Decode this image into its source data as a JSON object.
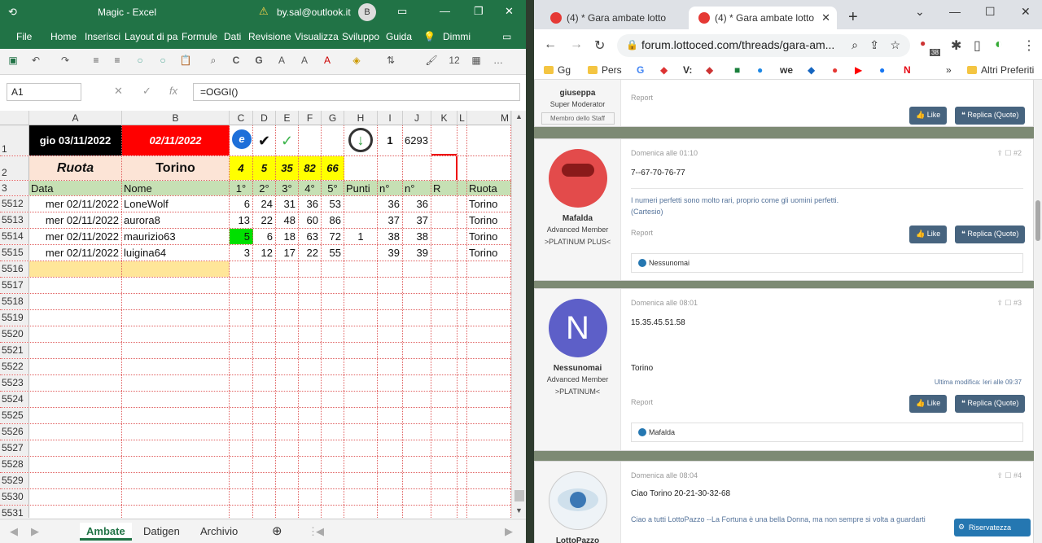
{
  "excel": {
    "title": "Magic - Excel",
    "account": "by.sal@outlook.it",
    "avatar": "B",
    "menu": [
      "File",
      "Home",
      "Inserisci",
      "Layout di pa",
      "Formule",
      "Dati",
      "Revisione",
      "Visualizza",
      "Sviluppo",
      "Guida",
      "Dimmi"
    ],
    "name_box": "A1",
    "formula": "=OGGI()",
    "fx": "fx",
    "columns": [
      "A",
      "B",
      "C",
      "D",
      "E",
      "F",
      "G",
      "H",
      "I",
      "J",
      "K",
      "L",
      "M"
    ],
    "row1": {
      "num": "1",
      "date_black": "gio 03/11/2022",
      "date_red": "02/11/2022",
      "i": "1",
      "j": "6293"
    },
    "row2": {
      "num": "2",
      "ruota": "Ruota",
      "city": "Torino",
      "nums": [
        "4",
        "5",
        "35",
        "82",
        "66"
      ]
    },
    "row3": {
      "num": "3",
      "headers": [
        "Data",
        "Nome",
        "1°",
        "2°",
        "3°",
        "4°",
        "5°",
        "Punti",
        "n°",
        "n°",
        "R",
        "",
        "Ruota"
      ]
    },
    "data_rows": [
      {
        "num": "5512",
        "data": "mer 02/11/2022",
        "nome": "LoneWolf",
        "v": [
          "6",
          "24",
          "31",
          "36",
          "53"
        ],
        "punti": "",
        "n1": "36",
        "n2": "36",
        "ruota": "Torino"
      },
      {
        "num": "5513",
        "data": "mer 02/11/2022",
        "nome": "aurora8",
        "v": [
          "13",
          "22",
          "48",
          "60",
          "86"
        ],
        "punti": "",
        "n1": "37",
        "n2": "37",
        "ruota": "Torino"
      },
      {
        "num": "5514",
        "data": "mer 02/11/2022",
        "nome": "maurizio63",
        "v": [
          "5",
          "6",
          "18",
          "63",
          "72"
        ],
        "punti": "1",
        "n1": "38",
        "n2": "38",
        "ruota": "Torino"
      },
      {
        "num": "5515",
        "data": "mer 02/11/2022",
        "nome": "luigina64",
        "v": [
          "3",
          "12",
          "17",
          "22",
          "55"
        ],
        "punti": "",
        "n1": "39",
        "n2": "39",
        "ruota": "Torino"
      }
    ],
    "empty_rows": [
      "5516",
      "5517",
      "5518",
      "5519",
      "5520",
      "5521",
      "5522",
      "5523",
      "5524",
      "5525",
      "5526",
      "5527",
      "5528",
      "5529",
      "5530",
      "5531"
    ],
    "sheets": [
      "Ambate",
      "Datigen",
      "Archivio"
    ],
    "active_sheet": "Ambate"
  },
  "browser": {
    "tab1": "(4) * Gara ambate lotto",
    "tab2": "(4) * Gara ambate lotto",
    "url": "forum.lottoced.com/threads/gara-am...",
    "ext_badge": "38",
    "bookmarks": [
      "Gg",
      "Pers",
      "Altri Preferiti"
    ],
    "posts": [
      {
        "user": "giuseppa",
        "role": "Super Moderator",
        "badge": "Membro dello Staff",
        "report": "Report",
        "like": "Like",
        "reply": "Replica (Quote)"
      },
      {
        "user": "Mafalda",
        "role": "Advanced Member",
        "rank": ">PLATINUM PLUS<",
        "date": "Domenica alle 01:10",
        "num": "#2",
        "msg": "7--67-70-76-77",
        "sig1": "I numeri perfetti sono molto rari, proprio come gli uomini perfetti.",
        "sig2": "(Cartesio)",
        "report": "Report",
        "like": "Like",
        "reply": "Replica (Quote)",
        "reaction": "Nessunomai"
      },
      {
        "user": "Nessunomai",
        "initial": "N",
        "role": "Advanced Member",
        "rank": ">PLATINUM<",
        "date": "Domenica alle 08:01",
        "num": "#3",
        "msg": "15.35.45.51.58",
        "msg2": "Torino",
        "edit": "Ultima modifica: Ieri alle 09:37",
        "report": "Report",
        "like": "Like",
        "reply": "Replica (Quote)",
        "reaction": "Mafalda"
      },
      {
        "user": "LottoPazzo",
        "date": "Domenica alle 08:04",
        "num": "#4",
        "msg": "Ciao Torino 20-21-30-32-68",
        "sig": "Ciao a tutti LottoPazzo --La Fortuna è una bella Donna, ma non sempre si volta a guardarti"
      }
    ],
    "privacy": "Riservatezza"
  },
  "colors": {
    "excel_green": "#217346",
    "yellow": "#ffff00",
    "red": "#ff0000",
    "hdr_peach": "#fce4d6",
    "hdr_green": "#c6e0b4",
    "hit_green": "#00e000",
    "forum_btn": "#47647f",
    "forum_blue": "#2577b1"
  }
}
